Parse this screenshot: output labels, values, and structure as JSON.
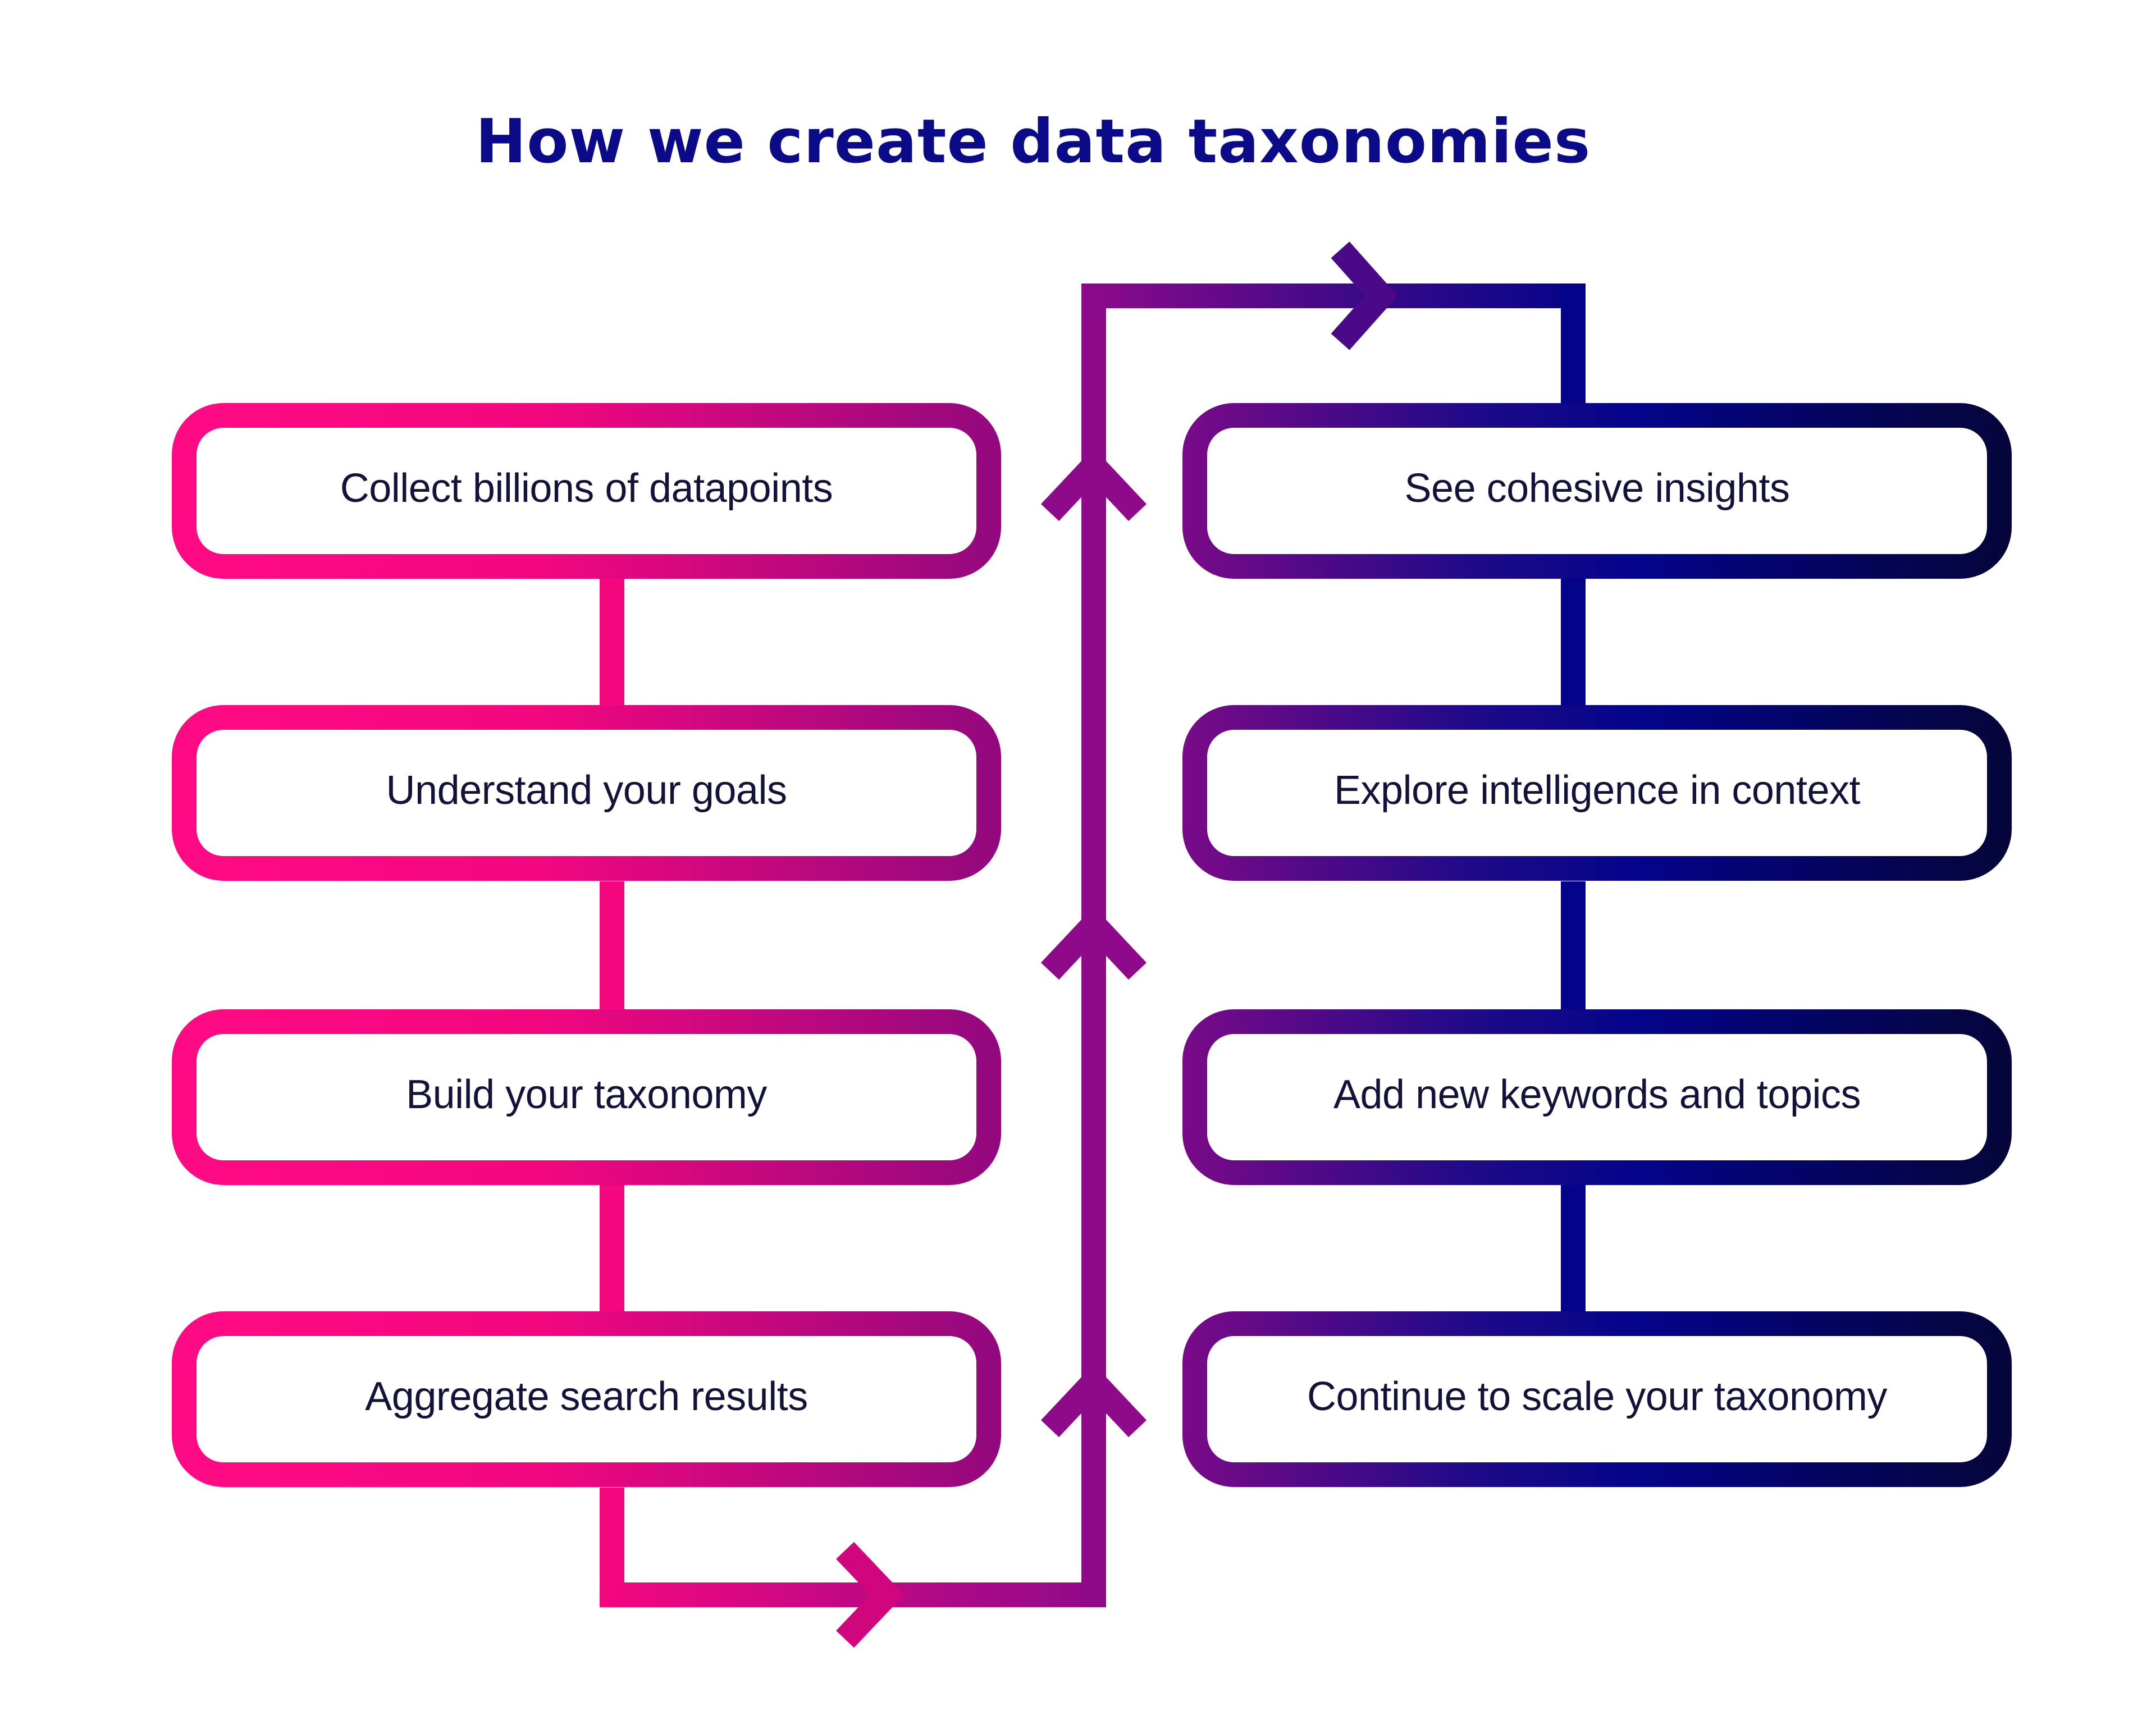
{
  "title": "How we create data taxonomies",
  "colors": {
    "title": "#0b0b8a",
    "text": "#12123a",
    "pink": "#ff0a84",
    "magenta": "#8e0a8a",
    "purple": "#6a0a86",
    "navy": "#04048a",
    "dark_navy": "#0a0a3c",
    "background": "#ffffff"
  },
  "left_column": {
    "steps": [
      {
        "label": "Collect billions of datapoints"
      },
      {
        "label": "Understand your goals"
      },
      {
        "label": "Build your taxonomy"
      },
      {
        "label": "Aggregate search results"
      }
    ]
  },
  "right_column": {
    "steps": [
      {
        "label": "See cohesive insights"
      },
      {
        "label": "Explore intelligence in context"
      },
      {
        "label": "Add new keywords and topics"
      },
      {
        "label": "Continue to scale your taxonomy"
      }
    ]
  },
  "flow": {
    "direction_left": "down",
    "direction_center": "up",
    "direction_top": "right",
    "direction_right": "down"
  }
}
